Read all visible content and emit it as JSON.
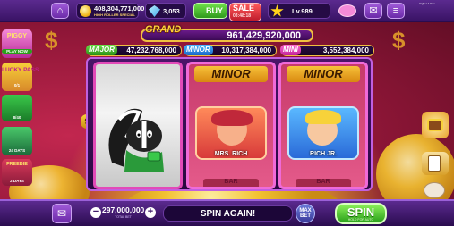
{
  "topbar": {
    "coins": "408,304,771,000",
    "coins_sub": "HIGH ROLLER SPECIAL",
    "gems": "3,053",
    "buy_label": "BUY",
    "sale_label": "SALE",
    "sale_timer": "03:48:18",
    "level_label": "Lv.989",
    "corner_note": "Higher 1.0.5x"
  },
  "left_panel": {
    "items": [
      {
        "title": "PIGGY",
        "sub": "PLAY NOW"
      },
      {
        "title": "LUCKY PASS",
        "sub": "0/1"
      },
      {
        "title": "",
        "sub": "8/40"
      },
      {
        "title": "",
        "sub": "24 DAYS"
      },
      {
        "title": "FREEBIE",
        "sub": "2 DAYS"
      }
    ]
  },
  "jackpots": {
    "grand_label": "GRAND",
    "grand_value": "961,429,920,000",
    "major_label": "MAJOR",
    "major_value": "47,232,768,000",
    "minor_label": "MINOR",
    "minor_value": "10,317,384,000",
    "mini_label": "MINI",
    "mini_value": "3,552,384,000"
  },
  "reels": {
    "reel2_header": "MINOR",
    "reel3_header": "MINOR",
    "reel2_symbol": "MRS. RICH",
    "reel3_symbol": "RICH JR.",
    "bar_text": "BAR"
  },
  "side_markers": {
    "left": "9",
    "right": "9"
  },
  "bottombar": {
    "bet_value": "297,000,000",
    "bet_label": "TOTAL BET",
    "spin_again": "SPIN AGAIN!",
    "maxbet_line1": "MAX",
    "maxbet_line2": "BET",
    "spin_label": "SPIN",
    "spin_sub": "HOLD FOR AUTO"
  },
  "colors": {
    "background": "#8e1637",
    "gold": "#f0c040",
    "spin_green": "#2aa01a",
    "reel_frame": "#c060e0"
  }
}
